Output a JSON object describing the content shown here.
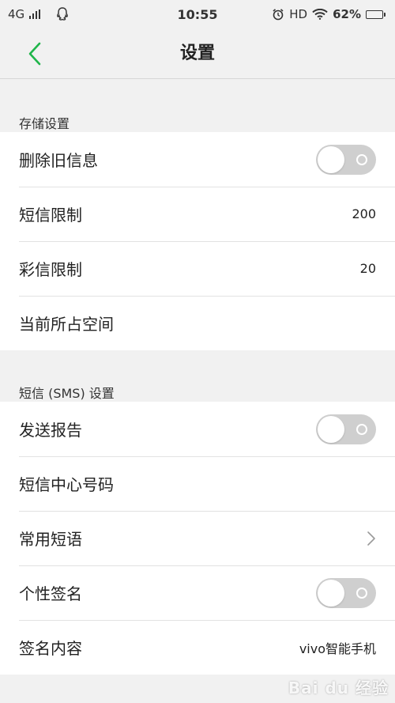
{
  "status_bar": {
    "network": "4G",
    "time": "10:55",
    "hd": "HD",
    "battery": "62%",
    "battery_level": 0.62
  },
  "header": {
    "title": "设置",
    "back_icon": "chevron-left-icon",
    "accent_color": "#1fb54a"
  },
  "storage_section": {
    "title": "存储设置",
    "items": [
      {
        "label": "删除旧信息",
        "toggle_on": false
      },
      {
        "label": "短信限制",
        "value": "200"
      },
      {
        "label": "彩信限制",
        "value": "20"
      },
      {
        "label": "当前所占空间"
      }
    ]
  },
  "sms_section": {
    "title": "短信 (SMS) 设置",
    "items": [
      {
        "label": "发送报告",
        "toggle_on": false
      },
      {
        "label": "短信中心号码"
      },
      {
        "label": "常用短语",
        "icon": "chevron-right-icon"
      },
      {
        "label": "个性签名",
        "toggle_on": false
      },
      {
        "label": "签名内容",
        "value": "vivo智能手机"
      }
    ]
  },
  "watermark": "Bai du 经验"
}
